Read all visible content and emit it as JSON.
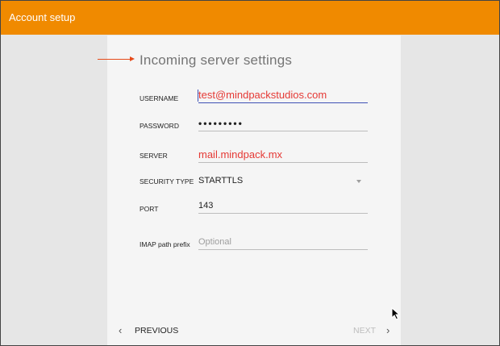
{
  "appbar": {
    "title": "Account setup"
  },
  "form": {
    "heading": "Incoming server settings",
    "username": {
      "label": "USERNAME",
      "value": "test@mindpackstudios.com"
    },
    "password": {
      "label": "PASSWORD",
      "value": "•••••••••"
    },
    "server": {
      "label": "SERVER",
      "value": "mail.mindpack.mx"
    },
    "security": {
      "label": "SECURITY TYPE",
      "value": "STARTTLS"
    },
    "port": {
      "label": "PORT",
      "value": "143"
    },
    "imap": {
      "label": "IMAP path prefix",
      "placeholder": "Optional"
    }
  },
  "nav": {
    "previous": "PREVIOUS",
    "next": "NEXT",
    "prev_icon": "‹",
    "next_icon": "›"
  },
  "colors": {
    "appbar": "#f08a00",
    "annotation": "#e64a19",
    "focus": "#3f51b5"
  }
}
